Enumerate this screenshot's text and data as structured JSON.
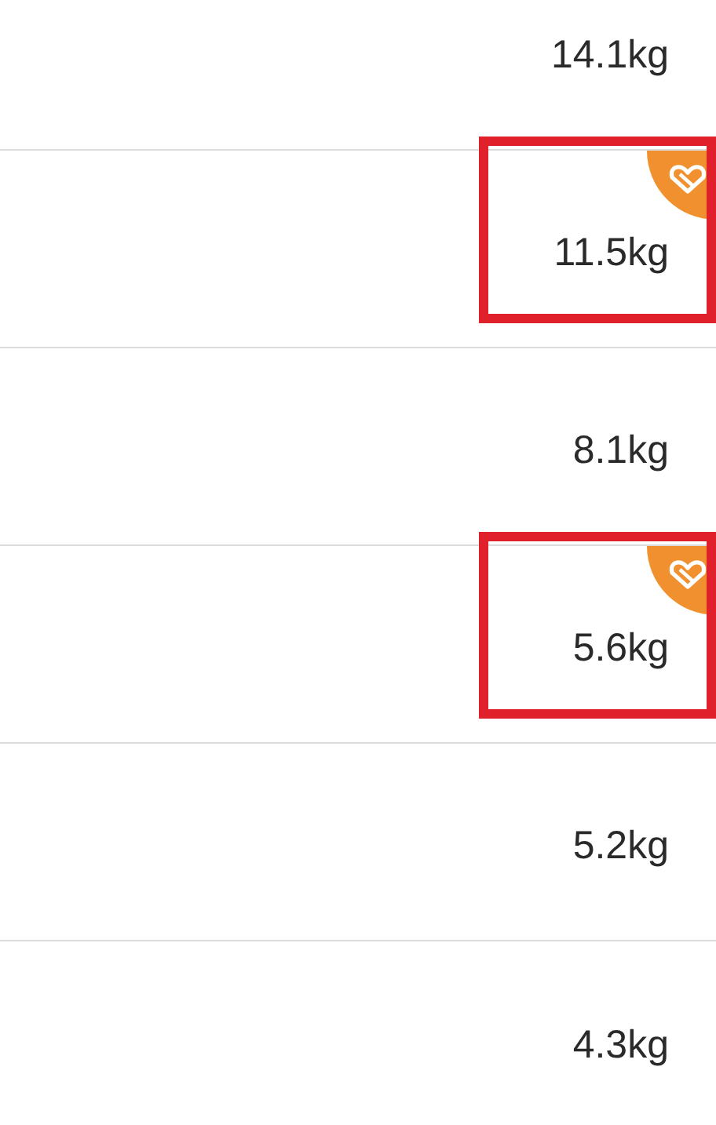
{
  "entries": [
    {
      "weight": "14.1kg",
      "badge": false,
      "highlighted": false
    },
    {
      "weight": "11.5kg",
      "badge": true,
      "highlighted": true
    },
    {
      "weight": "8.1kg",
      "badge": false,
      "highlighted": false
    },
    {
      "weight": "5.6kg",
      "badge": true,
      "highlighted": true
    },
    {
      "weight": "5.2kg",
      "badge": false,
      "highlighted": false
    },
    {
      "weight": "4.3kg",
      "badge": false,
      "highlighted": false
    }
  ]
}
